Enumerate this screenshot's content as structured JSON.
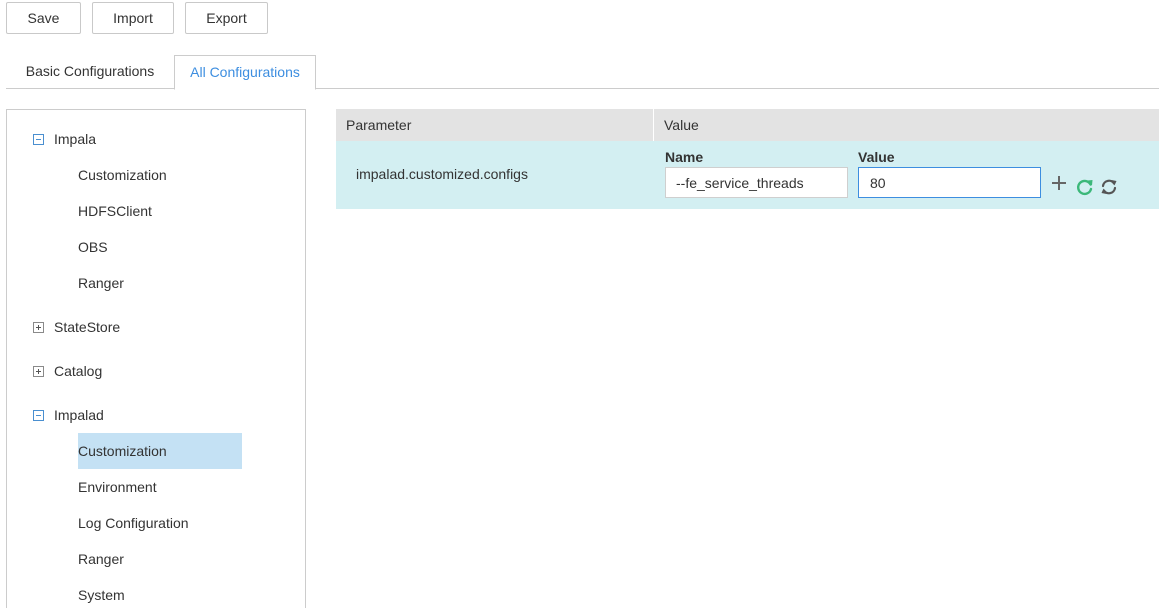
{
  "toolbar": {
    "save_label": "Save",
    "import_label": "Import",
    "export_label": "Export"
  },
  "tabs": {
    "basic_label": "Basic Configurations",
    "all_label": "All Configurations",
    "active": "All Configurations"
  },
  "tree": {
    "impala": {
      "label": "Impala",
      "expanded": true
    },
    "impala_children": [
      "Customization",
      "HDFSClient",
      "OBS",
      "Ranger"
    ],
    "statestore": {
      "label": "StateStore",
      "expanded": false
    },
    "catalog": {
      "label": "Catalog",
      "expanded": false
    },
    "impalad": {
      "label": "Impalad",
      "expanded": true
    },
    "impalad_children": [
      "Customization",
      "Environment",
      "Log Configuration",
      "Ranger",
      "System"
    ],
    "selected": "Impalad / Customization"
  },
  "grid": {
    "header_parameter": "Parameter",
    "header_value": "Value",
    "row": {
      "parameter": "impalad.customized.configs",
      "name_label": "Name",
      "value_label": "Value",
      "name_value": "--fe_service_threads",
      "value_value": "80"
    }
  },
  "icons": {
    "add": "plus-icon",
    "refresh": "refresh-icon",
    "sync": "sync-icon"
  },
  "colors": {
    "accent": "#3d8ee0",
    "row_highlight": "#d3eff2",
    "selected_item": "#c4e1f4",
    "header_bg": "#e3e3e3",
    "refresh_green": "#3cb87a"
  }
}
